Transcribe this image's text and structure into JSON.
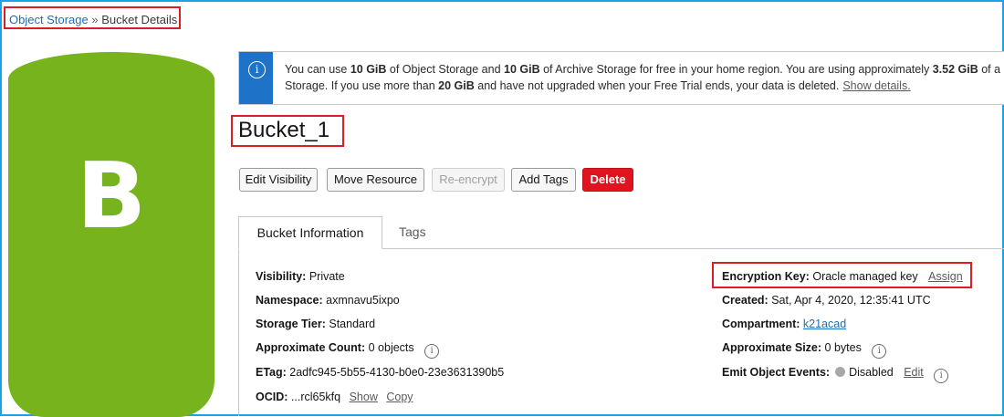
{
  "breadcrumb": {
    "root": "Object Storage",
    "separator": "»",
    "current": "Bucket Details"
  },
  "badge": {
    "letter": "B",
    "color": "#76b31c"
  },
  "notice": {
    "icon": "info-icon",
    "text_a": "You can use ",
    "free_os": "10 GiB",
    "text_b": " of Object Storage and ",
    "free_archive": "10 GiB",
    "text_c": " of Archive Storage for free in your home region. You are using approximately ",
    "used": "3.52 GiB",
    "text_d": " of a",
    "line2_a": "Storage. If you use more than ",
    "limit": "20 GiB",
    "line2_b": " and have not upgraded when your Free Trial ends, your data is deleted.",
    "show_details": "Show details."
  },
  "title": "Bucket_1",
  "actions": {
    "edit_visibility": "Edit Visibility",
    "move_resource": "Move Resource",
    "re_encrypt": "Re-encrypt",
    "add_tags": "Add Tags",
    "delete": "Delete"
  },
  "tabs": {
    "bucket_info": "Bucket Information",
    "tags": "Tags"
  },
  "info_left": {
    "visibility": {
      "label": "Visibility:",
      "value": "Private"
    },
    "namespace": {
      "label": "Namespace:",
      "value": "axmnavu5ixpo"
    },
    "storage_tier": {
      "label": "Storage Tier:",
      "value": "Standard"
    },
    "approx_count": {
      "label": "Approximate Count:",
      "value": "0 objects"
    },
    "etag": {
      "label": "ETag:",
      "value": "2adfc945-5b55-4130-b0e0-23e3631390b5"
    },
    "ocid": {
      "label": "OCID:",
      "value": "...rcl65kfq",
      "show": "Show",
      "copy": "Copy"
    }
  },
  "info_right": {
    "encryption_key": {
      "label": "Encryption Key:",
      "value": "Oracle managed key",
      "assign": "Assign"
    },
    "created": {
      "label": "Created:",
      "value": "Sat, Apr 4, 2020, 12:35:41 UTC"
    },
    "compartment": {
      "label": "Compartment:",
      "value": "k21acad"
    },
    "approx_size": {
      "label": "Approximate Size:",
      "value": "0 bytes"
    },
    "emit_events": {
      "label": "Emit Object Events:",
      "value": "Disabled",
      "edit": "Edit"
    }
  },
  "colors": {
    "highlight": "#d81f26",
    "frame": "#1ba3e8",
    "info_bar": "#1e73c8",
    "danger": "#e0141f",
    "link": "#1f6fb6"
  }
}
